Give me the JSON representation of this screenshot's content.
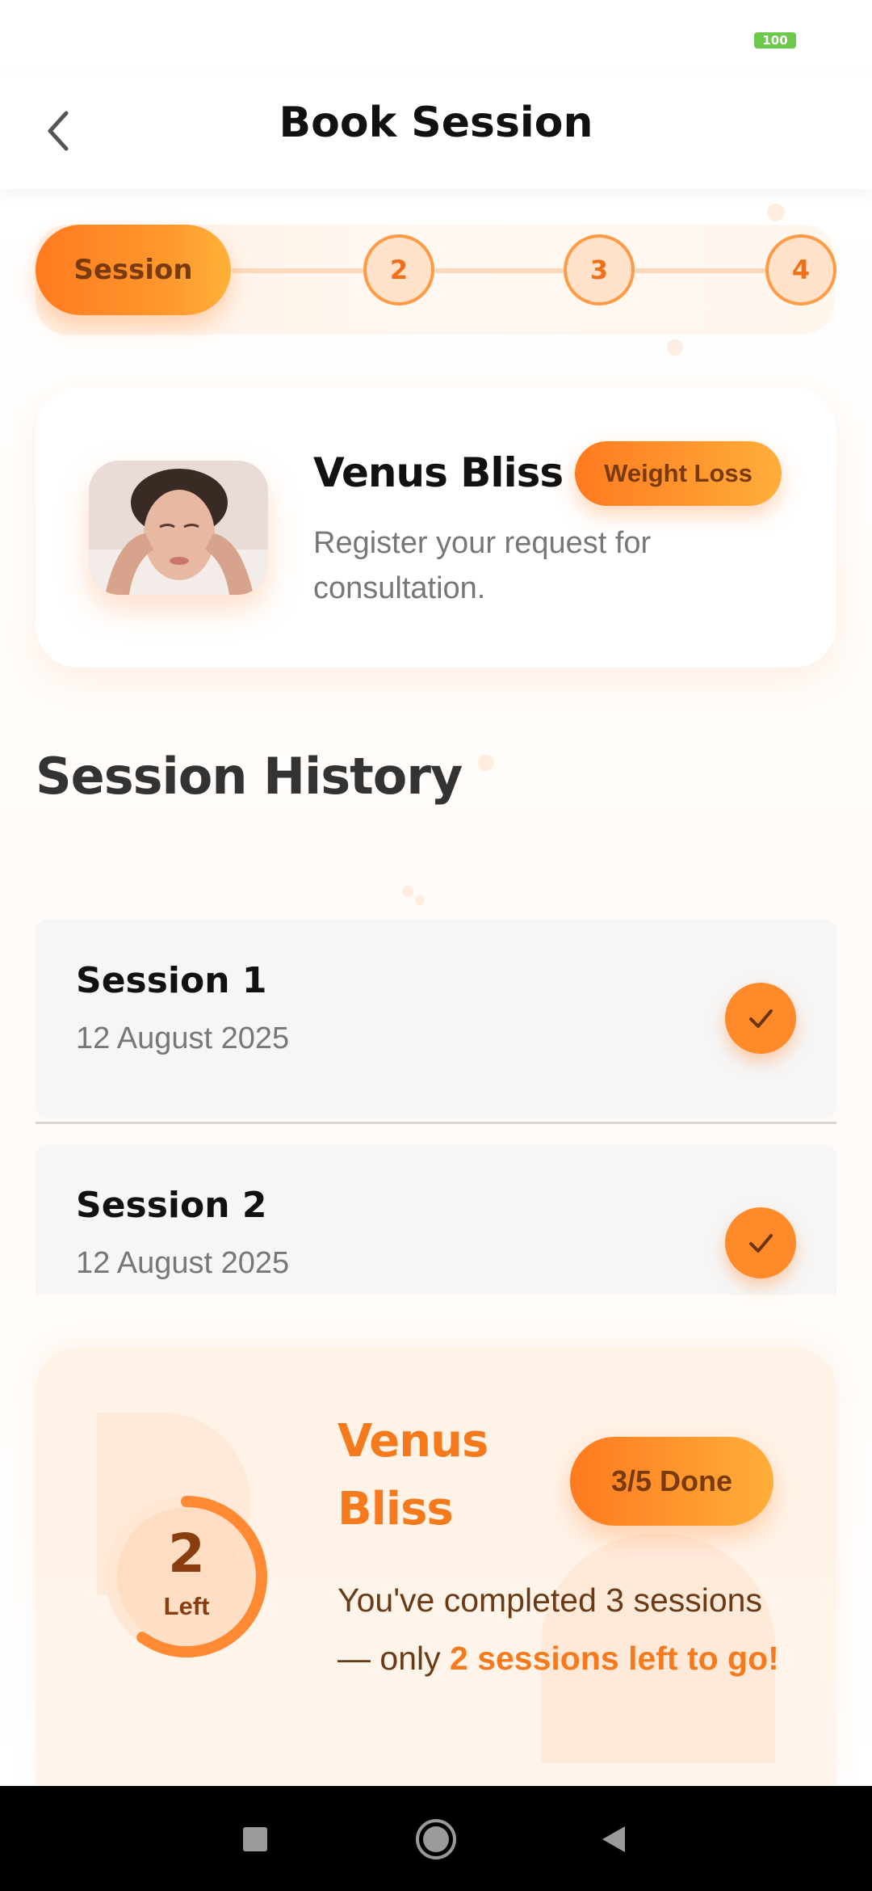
{
  "status_bar": {
    "battery": "100"
  },
  "header": {
    "title": "Book Session"
  },
  "stepper": {
    "active_label": "Session",
    "steps": [
      "2",
      "3",
      "4"
    ]
  },
  "service": {
    "name": "Venus Bliss",
    "tag": "Weight Loss",
    "description": "Register your request for consultation."
  },
  "history": {
    "title": "Session History",
    "items": [
      {
        "title": "Session 1",
        "date": "12 August 2025"
      },
      {
        "title": "Session 2",
        "date": "12 August 2025"
      }
    ]
  },
  "progress": {
    "remaining": "2",
    "remaining_label": "Left",
    "completed": 3,
    "total": 5,
    "name": "Venus Bliss",
    "badge": "3/5 Done",
    "text_prefix": "You've completed 3 sessions — only ",
    "text_highlight": "2 sessions left to go!"
  },
  "colors": {
    "accent": "#ff7a1f",
    "accent_light": "#ffae3a",
    "accent_text": "#f47a1d"
  }
}
